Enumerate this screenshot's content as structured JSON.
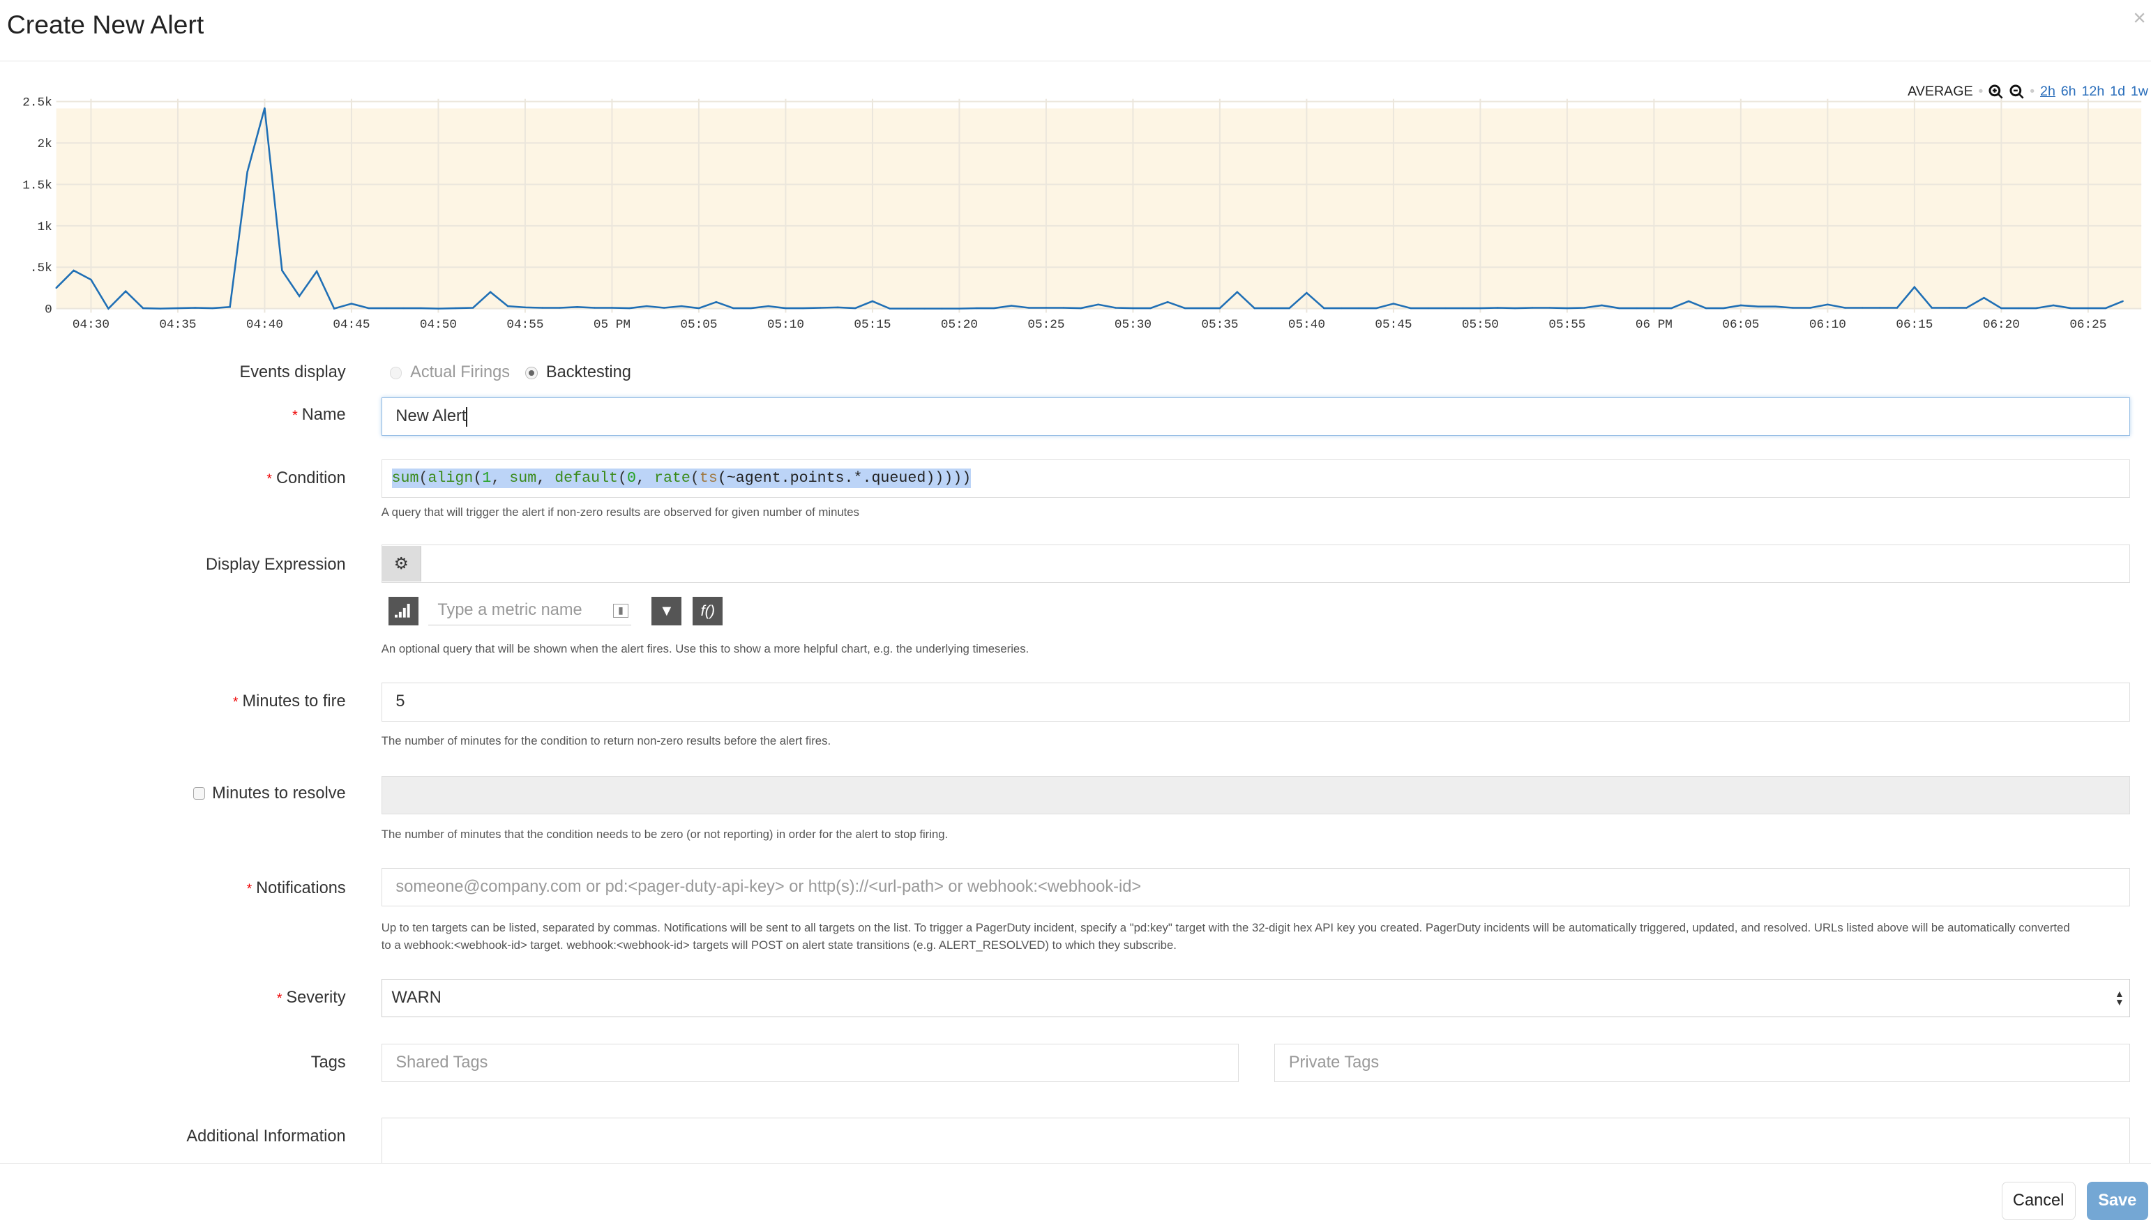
{
  "dialog": {
    "title": "Create New Alert",
    "close_icon": "close-icon"
  },
  "chart_controls": {
    "aggregation": "AVERAGE",
    "zoom_in_icon": "zoom-in-icon",
    "zoom_out_icon": "zoom-out-icon",
    "ranges": [
      "2h",
      "6h",
      "12h",
      "1d",
      "1w"
    ],
    "active_range": "2h"
  },
  "chart_data": {
    "type": "line",
    "title": "",
    "xlabel": "",
    "ylabel": "",
    "ylim": [
      0,
      2500
    ],
    "yticks": [
      "0",
      ".5k",
      "1k",
      "1.5k",
      "2k",
      "2.5k"
    ],
    "ytick_values": [
      0,
      500,
      1000,
      1500,
      2000,
      2500
    ],
    "xticks": [
      "04:30",
      "04:35",
      "04:40",
      "04:45",
      "04:50",
      "04:55",
      "05 PM",
      "05:05",
      "05:10",
      "05:15",
      "05:20",
      "05:25",
      "05:30",
      "05:35",
      "05:40",
      "05:45",
      "05:50",
      "05:55",
      "06 PM",
      "06:05",
      "06:10",
      "06:15",
      "06:20",
      "06:25"
    ],
    "x_range": [
      "04:28",
      "06:27"
    ],
    "grid": true,
    "background_color": "#fdf5e4",
    "line_color": "#1f6fb5",
    "series": [
      {
        "values": [
          250,
          460,
          350,
          0,
          210,
          5,
          0,
          5,
          10,
          5,
          20,
          1650,
          2420,
          460,
          150,
          450,
          0,
          60,
          5,
          5,
          5,
          5,
          0,
          5,
          10,
          200,
          30,
          15,
          10,
          10,
          20,
          10,
          10,
          5,
          30,
          10,
          30,
          5,
          80,
          5,
          5,
          30,
          5,
          5,
          10,
          15,
          5,
          90,
          0,
          0,
          0,
          0,
          0,
          5,
          5,
          35,
          10,
          10,
          10,
          5,
          50,
          10,
          5,
          5,
          80,
          5,
          5,
          5,
          200,
          5,
          5,
          5,
          190,
          5,
          5,
          5,
          5,
          60,
          5,
          5,
          5,
          5,
          5,
          10,
          5,
          10,
          10,
          5,
          10,
          40,
          5,
          5,
          5,
          5,
          90,
          5,
          5,
          40,
          25,
          25,
          10,
          10,
          50,
          10,
          10,
          10,
          10,
          260,
          10,
          10,
          10,
          130,
          5,
          5,
          5,
          40,
          5,
          5,
          5,
          90
        ]
      }
    ]
  },
  "form": {
    "events_display": {
      "label": "Events display",
      "options": [
        "Actual Firings",
        "Backtesting"
      ],
      "selected": "Backtesting"
    },
    "name": {
      "label": "Name",
      "value": "New Alert"
    },
    "condition": {
      "label": "Condition",
      "tokens": [
        {
          "text": "sum",
          "color": "#3a8a1a"
        },
        {
          "text": "(",
          "color": "#333"
        },
        {
          "text": "align",
          "color": "#3a8a1a"
        },
        {
          "text": "(",
          "color": "#333"
        },
        {
          "text": "1",
          "color": "#22a022"
        },
        {
          "text": ", ",
          "color": "#333"
        },
        {
          "text": "sum",
          "color": "#3a8a1a"
        },
        {
          "text": ", ",
          "color": "#333"
        },
        {
          "text": "default",
          "color": "#3a8a1a"
        },
        {
          "text": "(",
          "color": "#333"
        },
        {
          "text": "0",
          "color": "#22a022"
        },
        {
          "text": ", ",
          "color": "#333"
        },
        {
          "text": "rate",
          "color": "#3a8a1a"
        },
        {
          "text": "(",
          "color": "#333"
        },
        {
          "text": "ts",
          "color": "#a07840"
        },
        {
          "text": "(~agent.points.*.queued)))))",
          "color": "#222"
        }
      ],
      "help": "A query that will trigger the alert if non-zero results are observed for given number of minutes"
    },
    "display_expression": {
      "label": "Display Expression",
      "gear_icon": "gears-icon",
      "metric_placeholder": "Type a metric name",
      "help": "An optional query that will be shown when the alert fires. Use this to show a more helpful chart, e.g. the underlying timeseries.",
      "filter_icon": "filter-icon",
      "function_label": "f()"
    },
    "minutes_to_fire": {
      "label": "Minutes to fire",
      "value": "5",
      "help": "The number of minutes for the condition to return non-zero results before the alert fires."
    },
    "minutes_to_resolve": {
      "label": "Minutes to resolve",
      "checked": false,
      "help": "The number of minutes that the condition needs to be zero (or not reporting) in order for the alert to stop firing."
    },
    "notifications": {
      "label": "Notifications",
      "placeholder": "someone@company.com or pd:<pager-duty-api-key> or http(s)://<url-path> or webhook:<webhook-id>",
      "help_line1": "Up to ten targets can be listed, separated by commas. Notifications will be sent to all targets on the list. To trigger a PagerDuty incident, specify a \"pd:key\" target with the 32-digit hex API key you created. PagerDuty incidents will be automatically triggered, updated, and resolved. URLs listed above will be automatically converted",
      "help_line2": "to a webhook:<webhook-id> target. webhook:<webhook-id> targets will POST on alert state transitions (e.g. ALERT_RESOLVED) to which they subscribe."
    },
    "severity": {
      "label": "Severity",
      "value": "WARN"
    },
    "tags": {
      "label": "Tags",
      "shared_placeholder": "Shared Tags",
      "private_placeholder": "Private Tags"
    },
    "additional_info": {
      "label": "Additional Information"
    }
  },
  "footer": {
    "cancel_label": "Cancel",
    "save_label": "Save",
    "save_color": "#74a7d4"
  }
}
